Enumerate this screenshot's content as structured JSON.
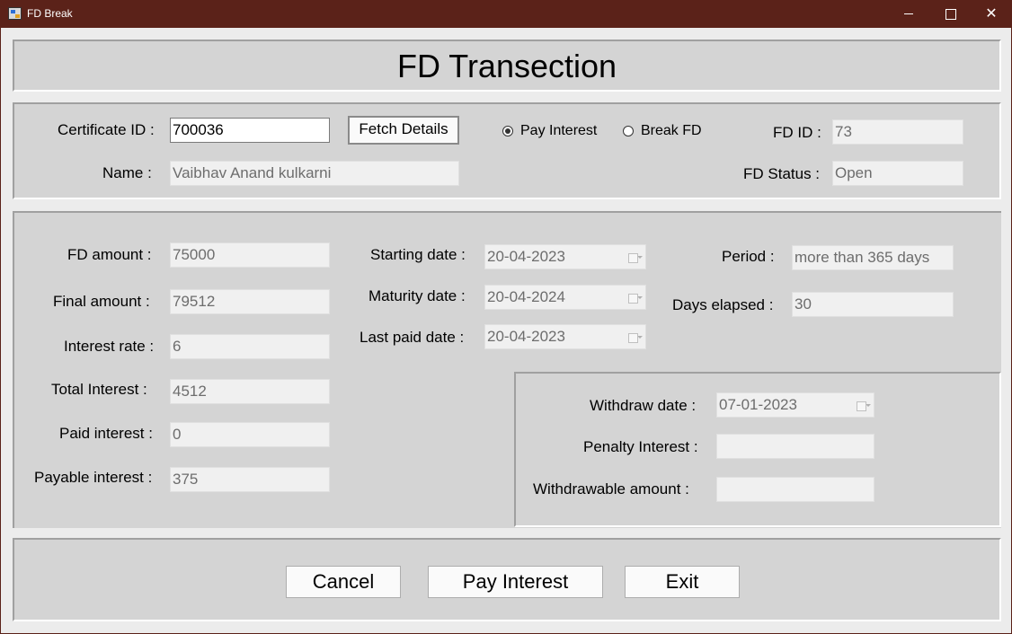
{
  "window": {
    "title": "FD Break",
    "minimize_glyph": "",
    "maximize_glyph": "",
    "close_glyph": "✕"
  },
  "header": {
    "title": "FD Transection"
  },
  "lookup": {
    "certificate_label": "Certificate ID :",
    "certificate_value": "700036",
    "fetch_button": "Fetch Details",
    "option_pay_interest": "Pay Interest",
    "option_break_fd": "Break FD",
    "selected_option": "Pay Interest",
    "fd_id_label": "FD ID :",
    "fd_id_value": "73",
    "name_label": "Name :",
    "name_value": "Vaibhav Anand kulkarni",
    "fd_status_label": "FD Status :",
    "fd_status_value": "Open"
  },
  "details": {
    "fd_amount_label": "FD amount :",
    "fd_amount_value": "75000",
    "final_amount_label": "Final amount :",
    "final_amount_value": "79512",
    "interest_rate_label": "Interest rate :",
    "interest_rate_value": "6",
    "total_interest_label": "Total Interest :",
    "total_interest_value": "4512",
    "paid_interest_label": "Paid interest :",
    "paid_interest_value": "0",
    "payable_interest_label": "Payable interest :",
    "payable_interest_value": "375",
    "starting_date_label": "Starting date :",
    "starting_date_value": "20-04-2023",
    "maturity_date_label": "Maturity date :",
    "maturity_date_value": "20-04-2024",
    "last_paid_date_label": "Last paid date :",
    "last_paid_date_value": "20-04-2023",
    "period_label": "Period :",
    "period_value": "more than 365 days",
    "days_elapsed_label": "Days elapsed :",
    "days_elapsed_value": "30"
  },
  "withdraw": {
    "withdraw_date_label": "Withdraw date :",
    "withdraw_date_value": "07-01-2023",
    "penalty_interest_label": "Penalty Interest :",
    "penalty_interest_value": "",
    "withdrawable_amount_label": "Withdrawable amount :",
    "withdrawable_amount_value": ""
  },
  "actions": {
    "cancel": "Cancel",
    "pay_interest": "Pay Interest",
    "exit": "Exit"
  },
  "colors": {
    "titlebar": "#5b2219",
    "panel": "#d4d4d4",
    "readonly_field": "#f0f0f0"
  }
}
